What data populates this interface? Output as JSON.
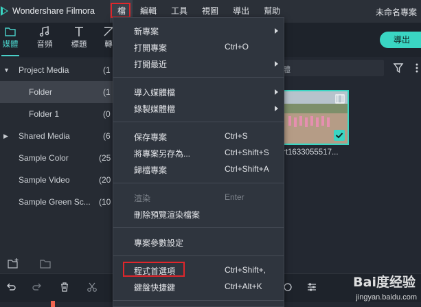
{
  "app": {
    "title": "Wondershare Filmora",
    "project_name": "未命名專案"
  },
  "menubar": [
    "檔",
    "編輯",
    "工具",
    "視圖",
    "導出",
    "幫助"
  ],
  "tabs": [
    {
      "label": "媒體",
      "icon": "folder-icon"
    },
    {
      "label": "音頻",
      "icon": "music-note-icon"
    },
    {
      "label": "標題",
      "icon": "text-t-icon"
    },
    {
      "label": "轉",
      "icon": "transition-icon"
    }
  ],
  "export_button": "導出",
  "sidebar": {
    "items": [
      {
        "label": "Project Media",
        "count": "(1",
        "arrow": "▼"
      },
      {
        "label": "Folder",
        "count": "(1",
        "arrow": ""
      },
      {
        "label": "Folder 1",
        "count": "(0",
        "arrow": ""
      },
      {
        "label": "Shared Media",
        "count": "(6",
        "arrow": "▶"
      },
      {
        "label": "Sample Color",
        "count": "(25",
        "arrow": ""
      },
      {
        "label": "Sample Video",
        "count": "(20",
        "arrow": ""
      },
      {
        "label": "Sample Green Sc...",
        "count": "(10",
        "arrow": ""
      }
    ]
  },
  "search": {
    "placeholder": "體"
  },
  "media": {
    "caption": "rt1633055517..."
  },
  "file_menu": [
    {
      "label": "新專案",
      "shortcut": "",
      "submenu": true,
      "disabled": false
    },
    {
      "label": "打開專案",
      "shortcut": "Ctrl+O",
      "submenu": false,
      "disabled": false
    },
    {
      "label": "打開最近",
      "shortcut": "",
      "submenu": true,
      "disabled": false
    },
    {
      "label": "導入媒體檔",
      "shortcut": "",
      "submenu": true,
      "disabled": false
    },
    {
      "label": "錄製媒體檔",
      "shortcut": "",
      "submenu": true,
      "disabled": false
    },
    {
      "label": "保存專案",
      "shortcut": "Ctrl+S",
      "submenu": false,
      "disabled": false
    },
    {
      "label": "將專案另存為...",
      "shortcut": "Ctrl+Shift+S",
      "submenu": false,
      "disabled": false
    },
    {
      "label": "歸檔專案",
      "shortcut": "Ctrl+Shift+A",
      "submenu": false,
      "disabled": false
    },
    {
      "label": "渲染",
      "shortcut": "Enter",
      "submenu": false,
      "disabled": true
    },
    {
      "label": "刪除預覽渲染檔案",
      "shortcut": "",
      "submenu": false,
      "disabled": false
    },
    {
      "label": "專案參數設定",
      "shortcut": "",
      "submenu": false,
      "disabled": false
    },
    {
      "label": "程式首選項",
      "shortcut": "Ctrl+Shift+,",
      "submenu": false,
      "disabled": false
    },
    {
      "label": "鍵盤快捷鍵",
      "shortcut": "Ctrl+Alt+K",
      "submenu": false,
      "disabled": false
    }
  ],
  "watermark": {
    "text": "Bai度经验",
    "url": "jingyan.baidu.com"
  },
  "colors": {
    "accent": "#3ad6c3",
    "highlight_box": "#e0262b",
    "background": "#232831",
    "menu_bg": "#2f353e"
  }
}
